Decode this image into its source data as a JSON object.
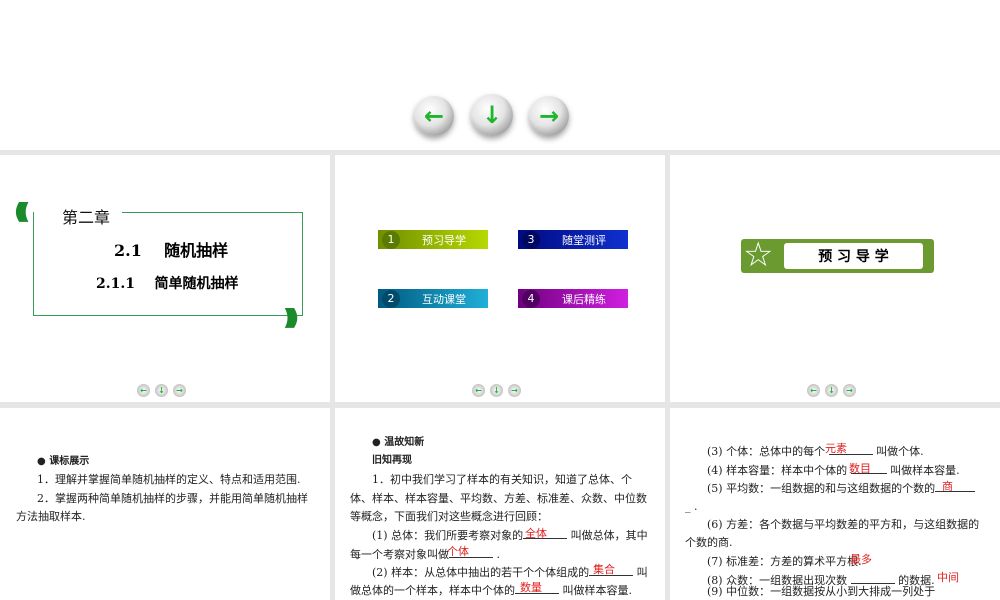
{
  "nav": {
    "prev": "←",
    "home": "↓",
    "next": "→"
  },
  "slide1": {
    "chapter": "第二章",
    "section_num": "2.1",
    "section_title": "随机抽样",
    "subsection_num": "2.1.1",
    "subsection_title": "简单随机抽样"
  },
  "slide2": {
    "menu": [
      {
        "num": "1",
        "label": "预习导学",
        "color": "#8fb400"
      },
      {
        "num": "2",
        "label": "互动课堂",
        "color": "#0f8fb8"
      },
      {
        "num": "3",
        "label": "随堂测评",
        "color": "#1020b0"
      },
      {
        "num": "4",
        "label": "课后精练",
        "color": "#b010c0"
      }
    ]
  },
  "slide3": {
    "title": "预 习 导 学"
  },
  "slide4": {
    "heading": "● 课标展示",
    "items": [
      "1．理解并掌握简单随机抽样的定义、特点和适用范围.",
      "2．掌握两种简单随机抽样的步骤，并能用简单随机抽样",
      "方法抽取样本."
    ]
  },
  "slide5": {
    "heading": "● 温故知新",
    "subheading": "旧知再现",
    "lines": [
      "1．初中我们学习了样本的有关知识，知道了总体、个",
      "体、样本、样本容量、平均数、方差、标准差、众数、中位数",
      "等概念，下面我们对这些概念进行回顾：",
      "(1) 总体：我们所要考察对象的",
      "叫做总体，其中",
      "每一个考察对象叫做",
      ".",
      "(2) 样本：从总体中抽出的若干个个体组成的",
      "叫",
      "做总体的一个样本，样本中个体的",
      "叫做样本容量."
    ],
    "answers": [
      "全体",
      "个体",
      "集合",
      "数量"
    ]
  },
  "slide6": {
    "lines": [
      "(3) 个体：总体中的每个",
      "叫做个体.",
      "(4) 样本容量：样本中个体的",
      "叫做样本容量.",
      "(5) 平均数：一组数据的和与这组数据的个数的",
      "_ .",
      "(6) 方差：各个数据与平均数差的平方和，与这组数据的",
      "个数的商.",
      "(7) 标准差：方差的算术平方根.",
      "(8) 众数：一组数据出现次数",
      "的数据.",
      "(9) 中位数：一组数据按从小到大排成一列处于"
    ],
    "answers": [
      "元素",
      "数目",
      "商",
      "最多",
      "中间"
    ]
  }
}
